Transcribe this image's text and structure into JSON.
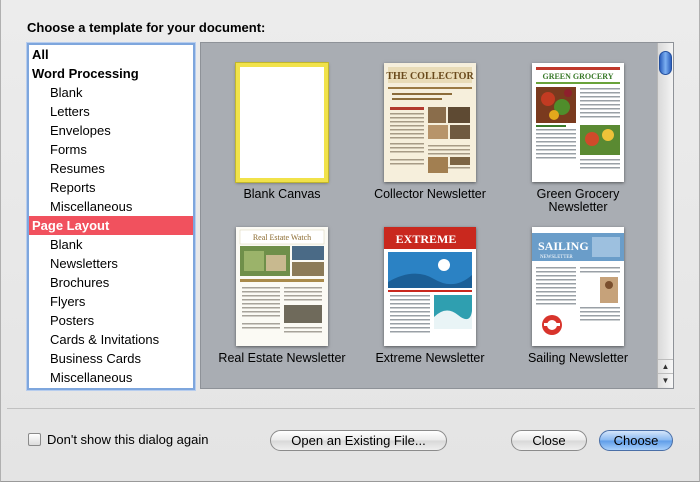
{
  "dialog": {
    "prompt": "Choose a template for your document:"
  },
  "sidebar": {
    "items": [
      {
        "label": "All",
        "kind": "group"
      },
      {
        "label": "Word Processing",
        "kind": "group"
      },
      {
        "label": "Blank",
        "kind": "item"
      },
      {
        "label": "Letters",
        "kind": "item"
      },
      {
        "label": "Envelopes",
        "kind": "item"
      },
      {
        "label": "Forms",
        "kind": "item"
      },
      {
        "label": "Resumes",
        "kind": "item"
      },
      {
        "label": "Reports",
        "kind": "item"
      },
      {
        "label": "Miscellaneous",
        "kind": "item"
      },
      {
        "label": "Page Layout",
        "kind": "group",
        "selected": true
      },
      {
        "label": "Blank",
        "kind": "item"
      },
      {
        "label": "Newsletters",
        "kind": "item"
      },
      {
        "label": "Brochures",
        "kind": "item"
      },
      {
        "label": "Flyers",
        "kind": "item"
      },
      {
        "label": "Posters",
        "kind": "item"
      },
      {
        "label": "Cards & Invitations",
        "kind": "item"
      },
      {
        "label": "Business Cards",
        "kind": "item"
      },
      {
        "label": "Miscellaneous",
        "kind": "item"
      }
    ]
  },
  "templates": [
    {
      "caption": "Blank Canvas",
      "selected": true
    },
    {
      "caption": "Collector Newsletter",
      "masthead": "THE COLLECTOR"
    },
    {
      "caption": "Green Grocery Newsletter",
      "caption_line1": "Green Grocery",
      "caption_line2": "Newsletter",
      "masthead": "GREEN GROCERY"
    },
    {
      "caption": "Real Estate Newsletter",
      "masthead": "Real Estate Watch"
    },
    {
      "caption": "Extreme Newsletter",
      "masthead": "EXTREME"
    },
    {
      "caption": "Sailing Newsletter",
      "masthead": "SAILING",
      "masthead_sub": "NEWSLETTER"
    }
  ],
  "footer": {
    "checkbox_label": "Don't show this dialog again",
    "checkbox_checked": false,
    "open_button": "Open an Existing File...",
    "close_button": "Close",
    "choose_button": "Choose"
  },
  "colors": {
    "selection_red": "#f1515e",
    "primary_blue": "#5d9ce8",
    "selected_thumb_border": "#f1e24a"
  }
}
